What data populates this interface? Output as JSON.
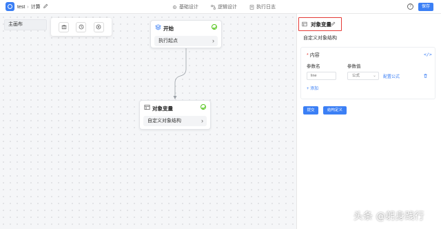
{
  "header": {
    "app_name": "test",
    "separator": "›",
    "page": "计算",
    "tabs": [
      {
        "label": "基础设计",
        "icon": "gear-icon"
      },
      {
        "label": "逻辑设计",
        "icon": "flow-icon"
      },
      {
        "label": "执行日志",
        "icon": "log-icon"
      }
    ],
    "help": "?",
    "save_label": "保存"
  },
  "canvas": {
    "main_canvas_label": "主画布",
    "toolbar": [
      {
        "icon": "package-icon"
      },
      {
        "icon": "clock-icon"
      },
      {
        "icon": "play-icon"
      }
    ],
    "nodes": [
      {
        "title": "开始",
        "body": "执行起点",
        "icon": "layers-icon",
        "status": "valid"
      },
      {
        "title": "对象变量",
        "body": "自定义对象结构",
        "icon": "table-icon",
        "status": "valid"
      }
    ]
  },
  "panel": {
    "title": "对象变量",
    "subtitle": "自定义对象结构",
    "section_label": "内容",
    "required_mark": "*",
    "code_toggle": "</>",
    "col_name": "参数名",
    "col_value": "参数值",
    "param": {
      "name": "line",
      "type": "公式",
      "config_label": "配置公式"
    },
    "add_label": "+ 添加",
    "submit_label": "提交",
    "struct_label": "结构定义"
  },
  "watermark": "头条 @躬身践行",
  "colors": {
    "accent": "#3b7ff5",
    "highlight": "#e53935",
    "success": "#52c41a"
  }
}
